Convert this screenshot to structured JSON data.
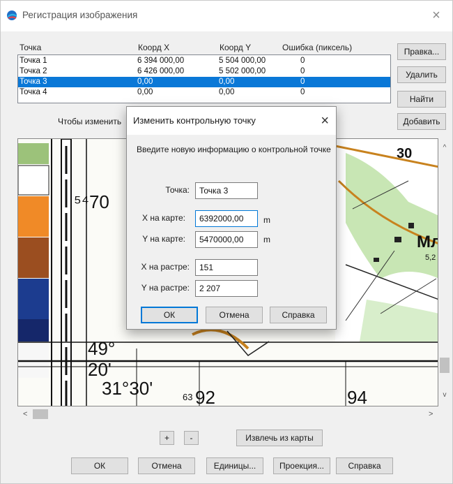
{
  "window": {
    "title": "Регистрация изображения"
  },
  "columns": [
    "Точка",
    "Коорд X",
    "Коорд Y",
    "Ошибка (пиксель)"
  ],
  "rows": [
    {
      "point": "Точка 1",
      "x": "6 394 000,00",
      "y": "5 504 000,00",
      "error": "0",
      "selected": false
    },
    {
      "point": "Точка 2",
      "x": "6 426 000,00",
      "y": "5 502 000,00",
      "error": "0",
      "selected": false
    },
    {
      "point": "Точка 3",
      "x": "0,00",
      "y": "0,00",
      "error": "0",
      "selected": true
    },
    {
      "point": "Точка 4",
      "x": "0,00",
      "y": "0,00",
      "error": "0",
      "selected": false
    }
  ],
  "side_buttons": {
    "edit": "Правка...",
    "delete": "Удалить",
    "find": "Найти",
    "add": "Добавить"
  },
  "hint": "Чтобы изменить",
  "map": {
    "labels": {
      "l1": "⁵⁴70",
      "l2": "49°",
      "l3": "20'",
      "l4": "31°30'",
      "l5": "63",
      "l6": "92",
      "l7": "94",
      "l8": "30",
      "l9": "Мл",
      "l10": "5,2"
    },
    "colors": {
      "orange": "#f08a27",
      "brown": "#9b4e20",
      "blue": "#1c3c8f",
      "darkblue": "#15276a",
      "green": "#c8e6b4",
      "road": "#c8821e"
    }
  },
  "zoom": {
    "plus": "+",
    "minus": "-"
  },
  "extract_button": "Извлечь из карты",
  "bottom_buttons": {
    "ok": "ОК",
    "cancel": "Отмена",
    "units": "Единицы...",
    "projection": "Проекция...",
    "help": "Справка"
  },
  "dialog": {
    "title": "Изменить контрольную точку",
    "description": "Введите новую информацию о контрольной точке",
    "point_label": "Точка:",
    "point_value": "Точка 3",
    "x_map_label": "X на карте:",
    "x_map_value": "6392000,00",
    "y_map_label": "Y на карте:",
    "y_map_value": "5470000,00",
    "unit": "m",
    "x_raster_label": "X на растре:",
    "x_raster_value": "151",
    "y_raster_label": "Y на растре:",
    "y_raster_value": "2 207",
    "ok": "ОК",
    "cancel": "Отмена",
    "help": "Справка"
  },
  "icons": {
    "close": "×",
    "scroll_up": "^",
    "scroll_down": "v",
    "scroll_left": "<",
    "scroll_right": ">"
  }
}
